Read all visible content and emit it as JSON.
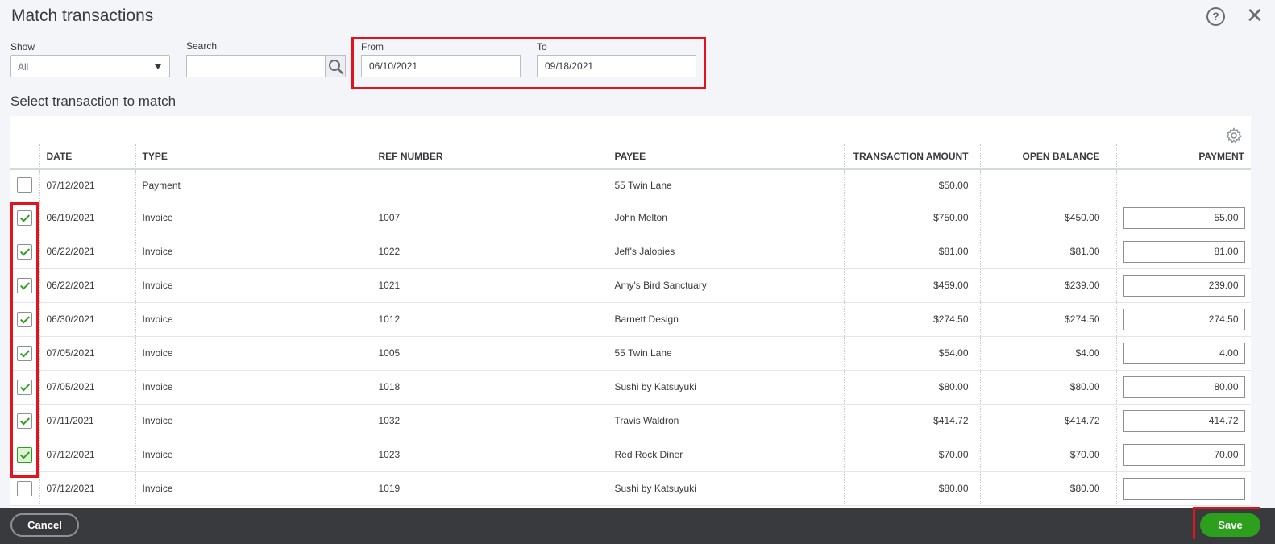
{
  "dialog": {
    "title": "Match transactions"
  },
  "filters": {
    "show_label": "Show",
    "show_value": "All",
    "search_label": "Search",
    "search_value": "",
    "from_label": "From",
    "from_value": "06/10/2021",
    "to_label": "To",
    "to_value": "09/18/2021"
  },
  "section_title": "Select transaction to match",
  "table": {
    "columns": [
      "DATE",
      "TYPE",
      "REF NUMBER",
      "PAYEE",
      "TRANSACTION AMOUNT",
      "OPEN BALANCE",
      "PAYMENT"
    ],
    "rows": [
      {
        "checked": false,
        "date": "07/12/2021",
        "type": "Payment",
        "ref": "",
        "payee": "55 Twin Lane",
        "amount": "$50.00",
        "balance": "",
        "payment": null
      },
      {
        "checked": true,
        "date": "06/19/2021",
        "type": "Invoice",
        "ref": "1007",
        "payee": "John Melton",
        "amount": "$750.00",
        "balance": "$450.00",
        "payment": "55.00"
      },
      {
        "checked": true,
        "date": "06/22/2021",
        "type": "Invoice",
        "ref": "1022",
        "payee": "Jeff's Jalopies",
        "amount": "$81.00",
        "balance": "$81.00",
        "payment": "81.00"
      },
      {
        "checked": true,
        "date": "06/22/2021",
        "type": "Invoice",
        "ref": "1021",
        "payee": "Amy's Bird Sanctuary",
        "amount": "$459.00",
        "balance": "$239.00",
        "payment": "239.00"
      },
      {
        "checked": true,
        "date": "06/30/2021",
        "type": "Invoice",
        "ref": "1012",
        "payee": "Barnett Design",
        "amount": "$274.50",
        "balance": "$274.50",
        "payment": "274.50"
      },
      {
        "checked": true,
        "date": "07/05/2021",
        "type": "Invoice",
        "ref": "1005",
        "payee": "55 Twin Lane",
        "amount": "$54.00",
        "balance": "$4.00",
        "payment": "4.00"
      },
      {
        "checked": true,
        "date": "07/05/2021",
        "type": "Invoice",
        "ref": "1018",
        "payee": "Sushi by Katsuyuki",
        "amount": "$80.00",
        "balance": "$80.00",
        "payment": "80.00"
      },
      {
        "checked": true,
        "date": "07/11/2021",
        "type": "Invoice",
        "ref": "1032",
        "payee": "Travis Waldron",
        "amount": "$414.72",
        "balance": "$414.72",
        "payment": "414.72"
      },
      {
        "checked": true,
        "date": "07/12/2021",
        "type": "Invoice",
        "ref": "1023",
        "payee": "Red Rock Diner",
        "amount": "$70.00",
        "balance": "$70.00",
        "payment": "70.00",
        "focused": true
      },
      {
        "checked": false,
        "date": "07/12/2021",
        "type": "Invoice",
        "ref": "1019",
        "payee": "Sushi by Katsuyuki",
        "amount": "$80.00",
        "balance": "$80.00",
        "payment": ""
      }
    ]
  },
  "footer": {
    "cancel_label": "Cancel",
    "save_label": "Save"
  },
  "icons": {
    "help": "help-icon",
    "close": "close-icon",
    "search": "search-icon",
    "settings": "gear-icon"
  },
  "colors": {
    "highlight": "#e3131d",
    "accent": "#2ca01c",
    "footer": "#393a3d"
  }
}
